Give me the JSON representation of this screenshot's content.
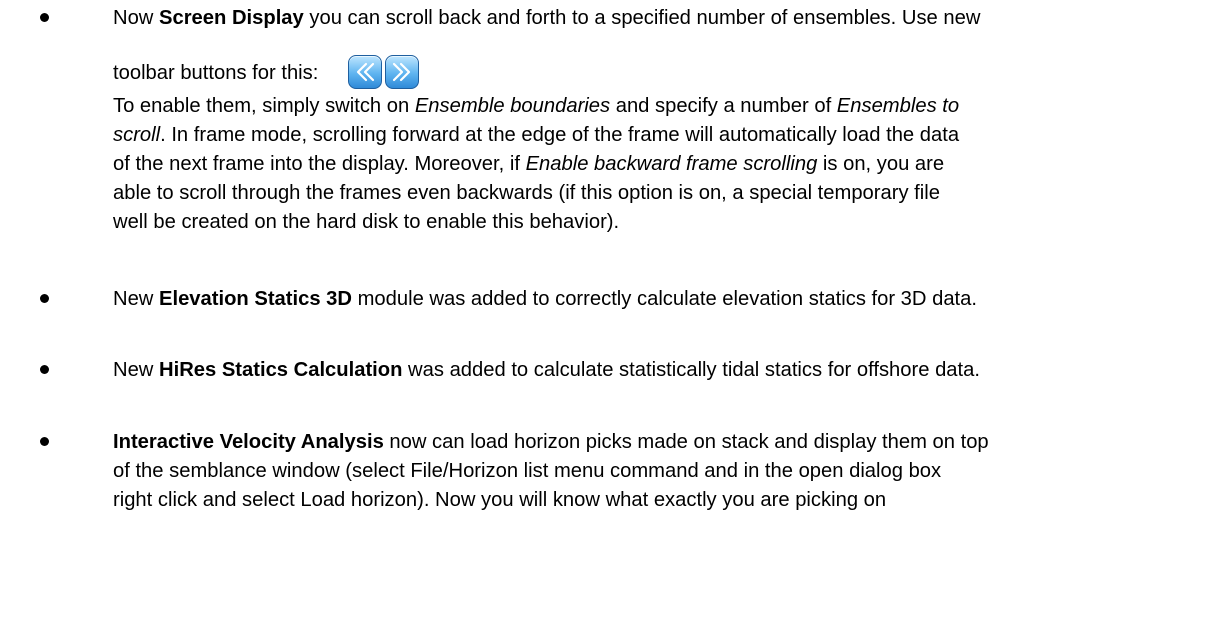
{
  "bullets": [
    {
      "lines": [
        [
          "Now ",
          "Screen Display",
          " you can scroll back and forth to a specified number of ensembles. Use new"
        ],
        [
          "toolbar buttons for this:"
        ],
        [
          "To enable them, simply switch on ",
          "Ensemble boundaries",
          " and specify a number of ",
          "Ensembles to"
        ],
        [
          "scroll",
          ". In frame mode, scrolling forward at the edge of the frame will automatically load the data"
        ],
        [
          "of the next frame into the display. Moreover, if ",
          "Enable backward frame scrolling",
          " is on, you are"
        ],
        [
          "able to scroll through the frames even backwards (if this option is on, a special temporary file"
        ],
        [
          "well be created on the hard disk to enable this behavior)."
        ]
      ]
    },
    {
      "lines": [
        [
          "New ",
          "Elevation Statics 3D",
          " module was added to correctly calculate elevation statics for 3D data."
        ]
      ]
    },
    {
      "lines": [
        [
          "New ",
          "HiRes Statics Calculation",
          " was added to calculate statistically tidal statics for offshore data."
        ]
      ]
    },
    {
      "lines": [
        [
          "Interactive Velocity Analysis",
          " now can load horizon picks made on stack and display them on top"
        ],
        [
          "of the semblance window (select File/Horizon list menu command and in the open dialog box"
        ],
        [
          "right click and select Load horizon). Now you will know what exactly you are picking on"
        ]
      ]
    }
  ],
  "toolbar_icons": [
    "scroll-back-icon",
    "scroll-forward-icon"
  ]
}
